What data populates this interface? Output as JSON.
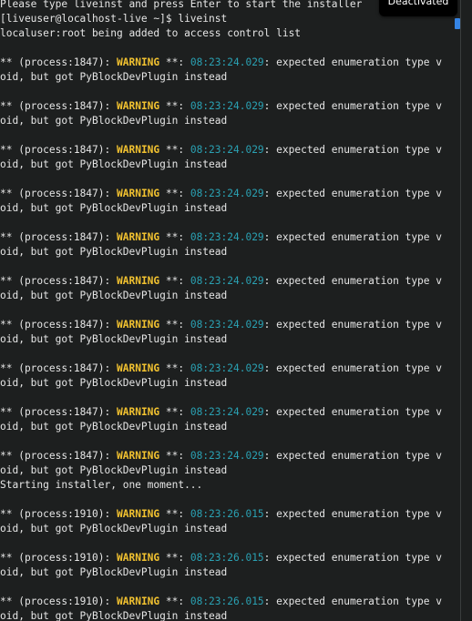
{
  "colors": {
    "background": "#1d1f1f",
    "text": "#e6e6e6",
    "warning": "#f2c230",
    "timestamp": "#2aa1b3",
    "scroll_thumb": "#3584e4"
  },
  "badge": {
    "text": "Deactivated"
  },
  "terminal": {
    "lines": [
      {
        "kind": "plain",
        "text": "Please type liveinst and press Enter to start the installer"
      },
      {
        "kind": "plain",
        "text": "[liveuser@localhost-live ~]$ liveinst"
      },
      {
        "kind": "plain",
        "text": "localuser:root being added to access control list"
      },
      {
        "kind": "plain",
        "text": ""
      },
      {
        "kind": "warning",
        "pid": "1847",
        "time": "08:23:24.029",
        "msg": ": expected enumeration type v"
      },
      {
        "kind": "plain",
        "text": "oid, but got PyBlockDevPlugin instead"
      },
      {
        "kind": "plain",
        "text": ""
      },
      {
        "kind": "warning",
        "pid": "1847",
        "time": "08:23:24.029",
        "msg": ": expected enumeration type v"
      },
      {
        "kind": "plain",
        "text": "oid, but got PyBlockDevPlugin instead"
      },
      {
        "kind": "plain",
        "text": ""
      },
      {
        "kind": "warning",
        "pid": "1847",
        "time": "08:23:24.029",
        "msg": ": expected enumeration type v"
      },
      {
        "kind": "plain",
        "text": "oid, but got PyBlockDevPlugin instead"
      },
      {
        "kind": "plain",
        "text": ""
      },
      {
        "kind": "warning",
        "pid": "1847",
        "time": "08:23:24.029",
        "msg": ": expected enumeration type v"
      },
      {
        "kind": "plain",
        "text": "oid, but got PyBlockDevPlugin instead"
      },
      {
        "kind": "plain",
        "text": ""
      },
      {
        "kind": "warning",
        "pid": "1847",
        "time": "08:23:24.029",
        "msg": ": expected enumeration type v"
      },
      {
        "kind": "plain",
        "text": "oid, but got PyBlockDevPlugin instead"
      },
      {
        "kind": "plain",
        "text": ""
      },
      {
        "kind": "warning",
        "pid": "1847",
        "time": "08:23:24.029",
        "msg": ": expected enumeration type v"
      },
      {
        "kind": "plain",
        "text": "oid, but got PyBlockDevPlugin instead"
      },
      {
        "kind": "plain",
        "text": ""
      },
      {
        "kind": "warning",
        "pid": "1847",
        "time": "08:23:24.029",
        "msg": ": expected enumeration type v"
      },
      {
        "kind": "plain",
        "text": "oid, but got PyBlockDevPlugin instead"
      },
      {
        "kind": "plain",
        "text": ""
      },
      {
        "kind": "warning",
        "pid": "1847",
        "time": "08:23:24.029",
        "msg": ": expected enumeration type v"
      },
      {
        "kind": "plain",
        "text": "oid, but got PyBlockDevPlugin instead"
      },
      {
        "kind": "plain",
        "text": ""
      },
      {
        "kind": "warning",
        "pid": "1847",
        "time": "08:23:24.029",
        "msg": ": expected enumeration type v"
      },
      {
        "kind": "plain",
        "text": "oid, but got PyBlockDevPlugin instead"
      },
      {
        "kind": "plain",
        "text": ""
      },
      {
        "kind": "warning",
        "pid": "1847",
        "time": "08:23:24.029",
        "msg": ": expected enumeration type v"
      },
      {
        "kind": "plain",
        "text": "oid, but got PyBlockDevPlugin instead"
      },
      {
        "kind": "plain",
        "text": "Starting installer, one moment..."
      },
      {
        "kind": "plain",
        "text": ""
      },
      {
        "kind": "warning",
        "pid": "1910",
        "time": "08:23:26.015",
        "msg": ": expected enumeration type v"
      },
      {
        "kind": "plain",
        "text": "oid, but got PyBlockDevPlugin instead"
      },
      {
        "kind": "plain",
        "text": ""
      },
      {
        "kind": "warning",
        "pid": "1910",
        "time": "08:23:26.015",
        "msg": ": expected enumeration type v"
      },
      {
        "kind": "plain",
        "text": "oid, but got PyBlockDevPlugin instead"
      },
      {
        "kind": "plain",
        "text": ""
      },
      {
        "kind": "warning",
        "pid": "1910",
        "time": "08:23:26.015",
        "msg": ": expected enumeration type v"
      },
      {
        "kind": "plain",
        "text": "oid, but got PyBlockDevPlugin instead"
      }
    ]
  }
}
